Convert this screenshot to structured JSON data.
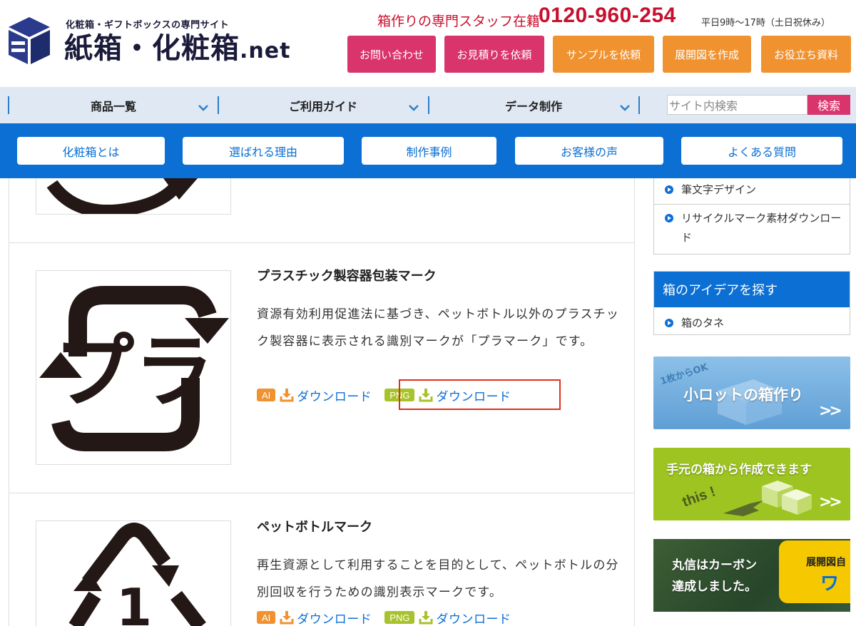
{
  "header": {
    "tagline": "化粧箱・ギフトボックスの専門サイト",
    "site_name": "紙箱・化粧箱",
    "site_tld": ".net",
    "staff_text": "箱作りの専門スタッフ在籍",
    "phone": "0120-960-254",
    "hours": "平日9時〜17時（土日祝休み）",
    "buttons": [
      "お問い合わせ",
      "お見積りを依頼",
      "サンプルを依頼",
      "展開図を作成",
      "お役立ち資料"
    ],
    "colors": {
      "pink": "#d9346b",
      "orange": "#f0922f",
      "red": "#c8102e"
    }
  },
  "nav": {
    "items": [
      "商品一覧",
      "ご利用ガイド",
      "データ制作"
    ],
    "search_placeholder": "サイト内検索",
    "search_button": "検索"
  },
  "subnav": {
    "items": [
      "化粧箱とは",
      "選ばれる理由",
      "制作事例",
      "お客様の声",
      "よくある質問"
    ],
    "color": "#0b6fd4"
  },
  "items": [
    {
      "title": "プラスチック製容器包装マーク",
      "description": "資源有効利用促進法に基づき、ペットボトル以外のプラスチック製容器に表示される識別マークが「プラマーク」です。",
      "mark_text": "プラ",
      "downloads": [
        {
          "badge": "AI",
          "label": "ダウンロード"
        },
        {
          "badge": "PNG",
          "label": "ダウンロード"
        }
      ]
    },
    {
      "title": "ペットボトルマーク",
      "description": "再生資源として利用することを目的として、ペットボトルの分別回収を行うための識別表示マークです。",
      "mark_text": "1",
      "downloads": [
        {
          "badge": "AI",
          "label": "ダウンロード"
        },
        {
          "badge": "PNG",
          "label": "ダウンロード"
        }
      ]
    }
  ],
  "sidebar": {
    "links": [
      "筆文字デザイン",
      "リサイクルマーク素材ダウンロード"
    ],
    "idea_heading": "箱のアイデアを探す",
    "idea_links": [
      "箱のタネ"
    ],
    "banners": [
      {
        "small": "1枚からOK",
        "text": "小ロットの箱作り"
      },
      {
        "text": "手元の箱から作成できます",
        "small": "this !"
      },
      {
        "text": "丸信はカーボン\n達成しました。",
        "tag": "展開図自",
        "tag2": "ワ"
      }
    ]
  }
}
